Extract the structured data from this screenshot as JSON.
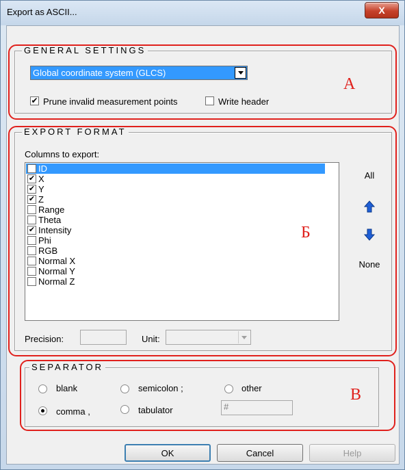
{
  "window": {
    "title": "Export as ASCII...",
    "close_label": "X"
  },
  "general": {
    "title": "GENERAL SETTINGS",
    "coord_select": "Global coordinate system (GLCS)",
    "prune_label": "Prune invalid measurement points",
    "prune_checked": true,
    "header_label": "Write header",
    "header_checked": false,
    "marker": "A"
  },
  "export_format": {
    "title": "EXPORT FORMAT",
    "columns_label": "Columns to export:",
    "columns": [
      {
        "label": "ID",
        "checked": false,
        "selected": true
      },
      {
        "label": "X",
        "checked": true,
        "selected": false
      },
      {
        "label": "Y",
        "checked": true,
        "selected": false
      },
      {
        "label": "Z",
        "checked": true,
        "selected": false
      },
      {
        "label": "Range",
        "checked": false,
        "selected": false
      },
      {
        "label": "Theta",
        "checked": false,
        "selected": false
      },
      {
        "label": "Intensity",
        "checked": true,
        "selected": false
      },
      {
        "label": "Phi",
        "checked": false,
        "selected": false
      },
      {
        "label": "RGB",
        "checked": false,
        "selected": false
      },
      {
        "label": "Normal X",
        "checked": false,
        "selected": false
      },
      {
        "label": "Normal Y",
        "checked": false,
        "selected": false
      },
      {
        "label": "Normal Z",
        "checked": false,
        "selected": false
      }
    ],
    "all_label": "All",
    "none_label": "None",
    "precision_label": "Precision:",
    "precision_value": "",
    "unit_label": "Unit:",
    "unit_value": "",
    "marker": "Б",
    "arrow_color": "#1f5fd6"
  },
  "separator": {
    "title": "SEPARATOR",
    "options": {
      "blank": "blank",
      "semicolon": "semicolon ;",
      "other": "other",
      "comma": "comma ,",
      "tabulator": "tabulator"
    },
    "selected": "comma",
    "other_value": "#",
    "marker": "B"
  },
  "buttons": {
    "ok": "OK",
    "cancel": "Cancel",
    "help": "Help"
  },
  "colors": {
    "annotation_red": "#e0201c",
    "selection_blue": "#3399ff"
  }
}
